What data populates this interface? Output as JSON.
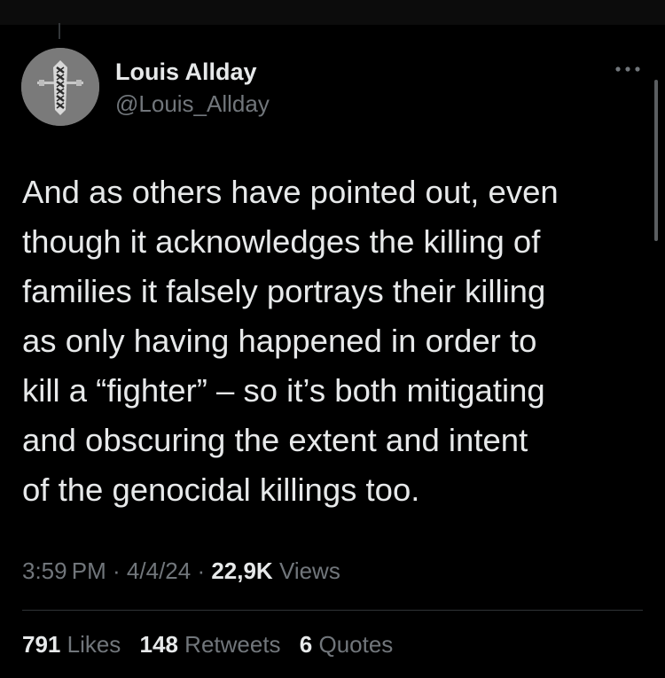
{
  "author": {
    "display_name": "Louis Allday",
    "handle": "@Louis_Allday",
    "avatar": "keffiyeh-pattern-avatar"
  },
  "tweet": {
    "text": "And as others have pointed out, even\nthough it acknowledges the killing of\nfamilies it falsely portrays their killing\nas only having happened in order to\nkill a “fighter” – so it’s both mitigating\nand obscuring the extent and intent\nof the genocidal killings too."
  },
  "meta": {
    "time": "3:59 PM",
    "separator": " · ",
    "date": "4/4/24",
    "views_count": "22,9K",
    "views_label": " Views"
  },
  "stats": {
    "likes_count": "791",
    "likes_label": " Likes",
    "retweets_count": "148",
    "retweets_label": " Retweets",
    "quotes_count": "6",
    "quotes_label": " Quotes"
  },
  "icons": {
    "more": "more-horizontal-icon"
  },
  "colors": {
    "background": "#000000",
    "primary_text": "#e7e9ea",
    "secondary_text": "#71767b",
    "divider": "#2f3336"
  }
}
